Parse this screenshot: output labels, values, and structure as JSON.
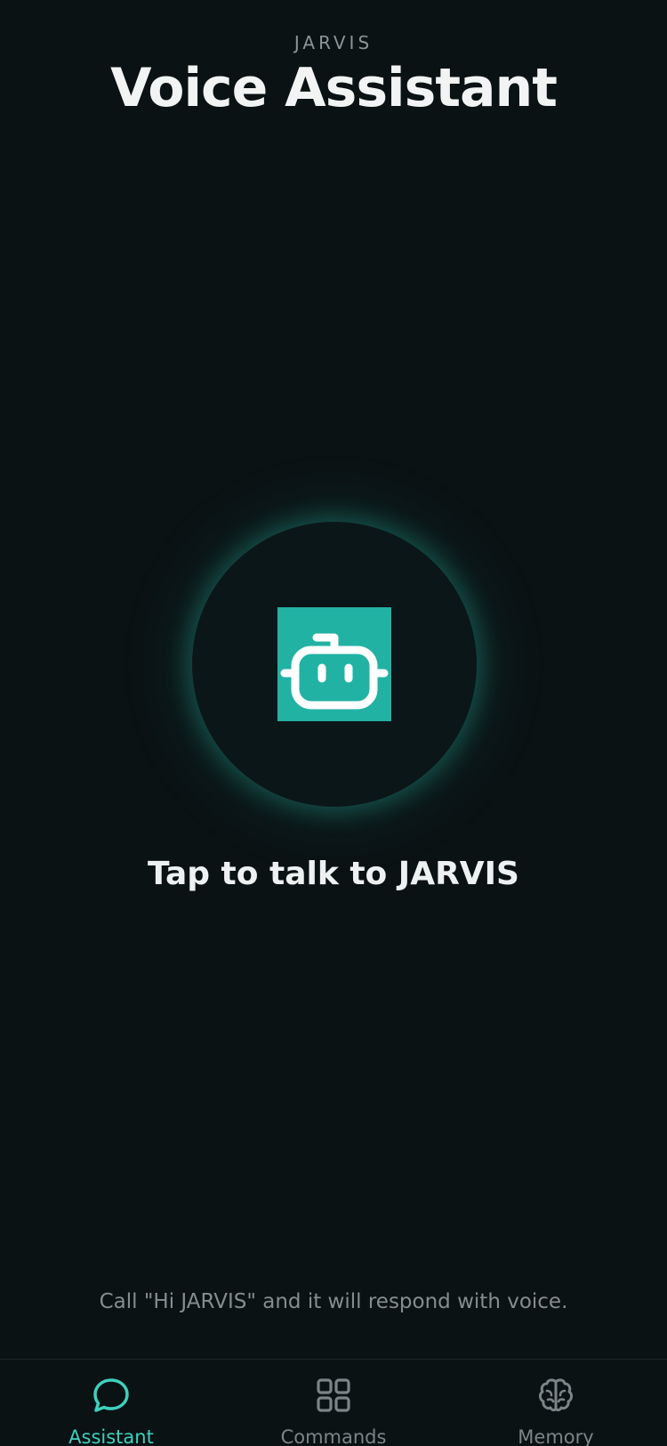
{
  "header": {
    "eyebrow": "JARVIS",
    "title": "Voice Assistant"
  },
  "main": {
    "talk_button_icon": "robot-icon",
    "prompt": "Tap to talk to JARVIS",
    "hint": "Call \"Hi JARVIS\" and it will respond with voice."
  },
  "tabbar": {
    "active": "Assistant",
    "tabs": [
      {
        "label": "Assistant",
        "icon": "chat-bubble-icon"
      },
      {
        "label": "Commands",
        "icon": "grid-icon"
      },
      {
        "label": "Memory",
        "icon": "brain-icon"
      }
    ]
  },
  "colors": {
    "background": "#0b1214",
    "accent": "#22b2a4",
    "active_tab": "#3fd0bd",
    "inactive_tab": "#7b8486"
  }
}
